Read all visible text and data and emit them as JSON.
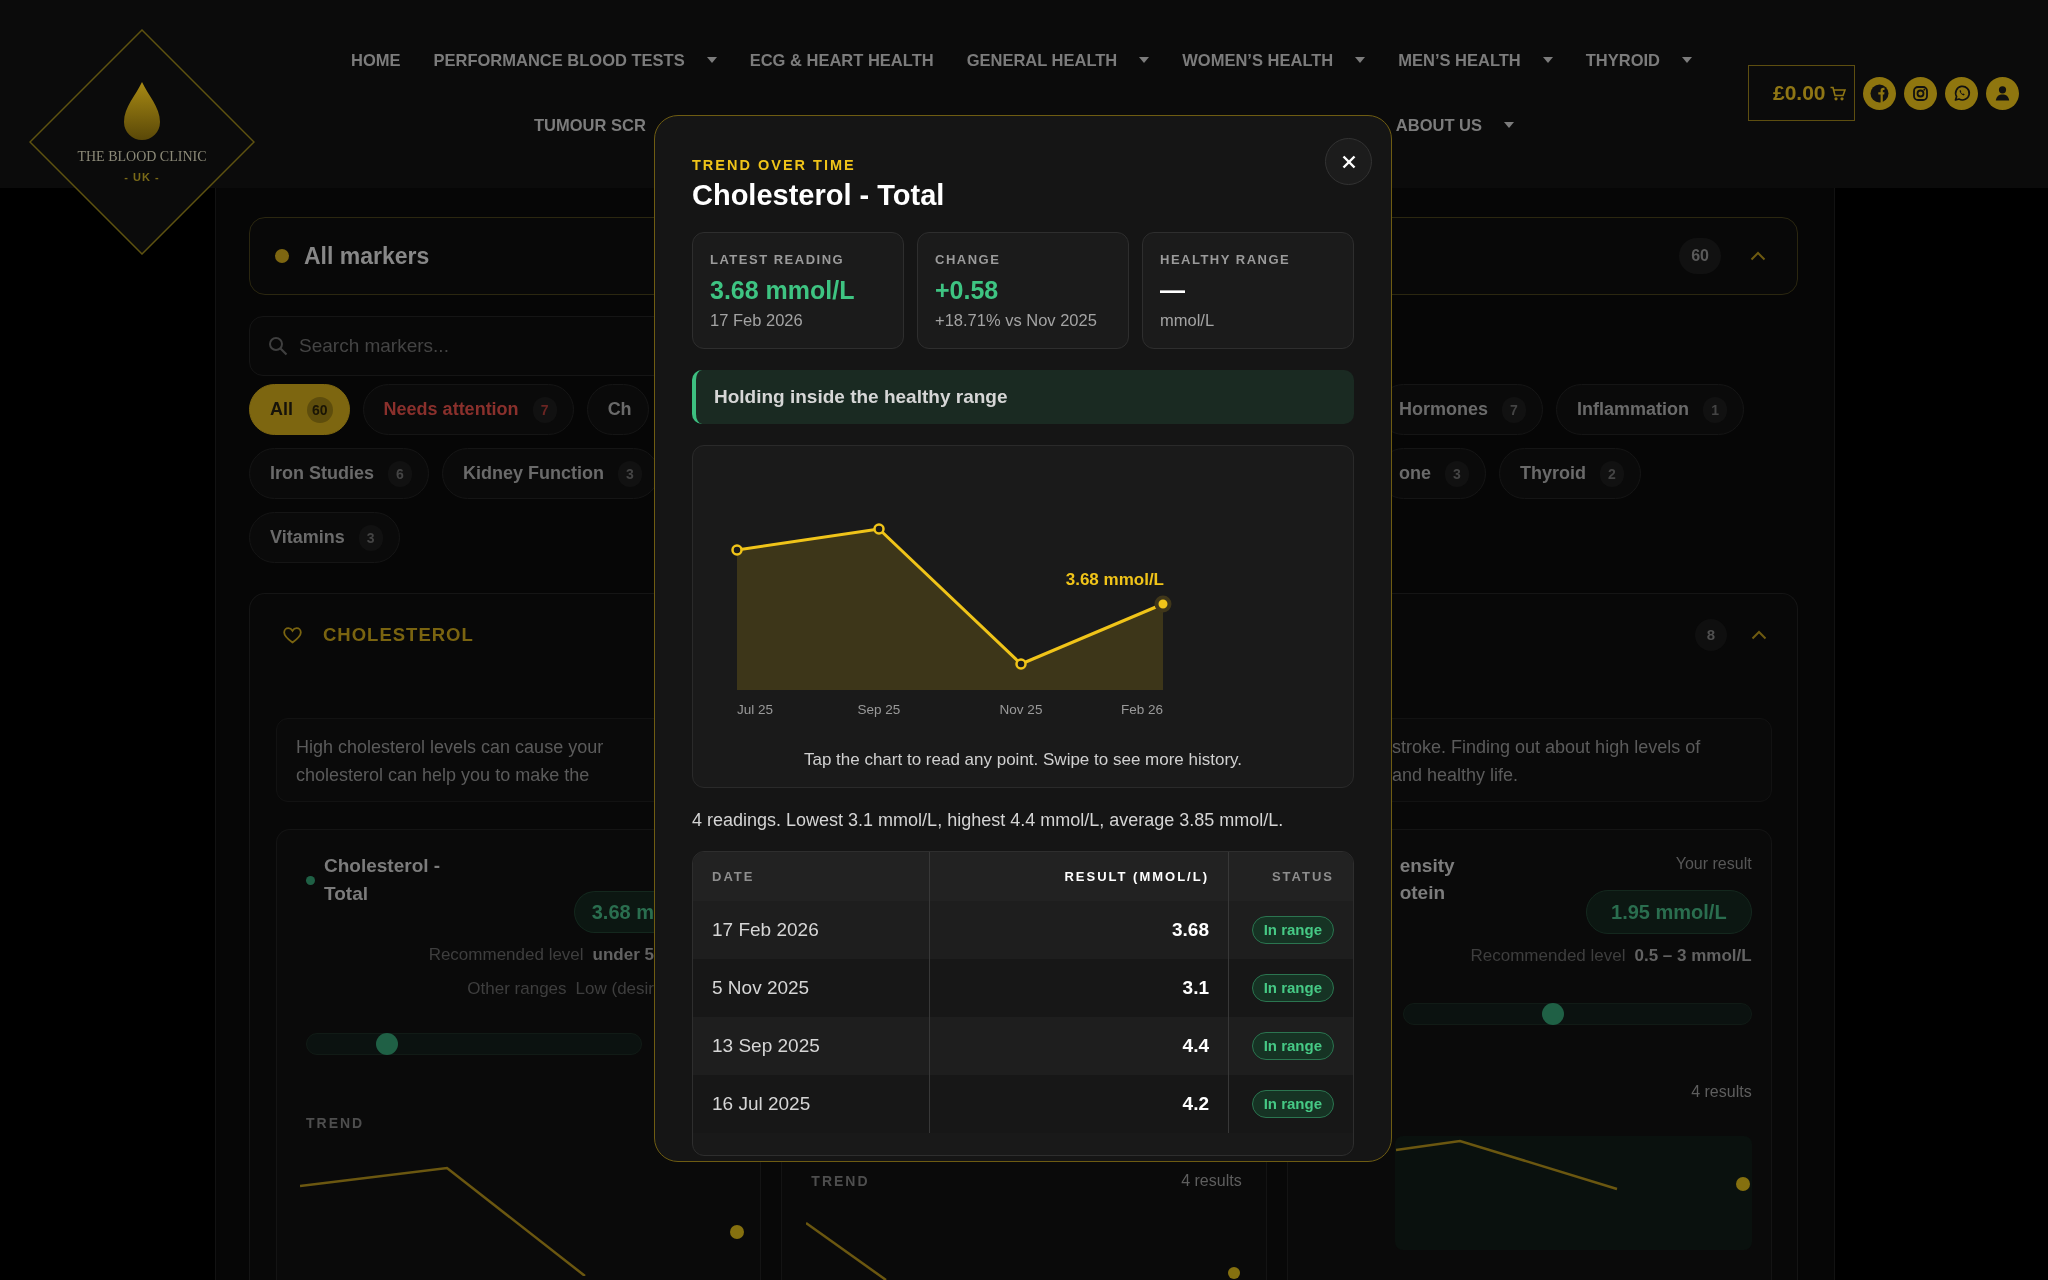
{
  "header": {
    "logo": {
      "name": "THE BLOOD CLINIC",
      "tagline": "- UK -"
    },
    "nav_rows": [
      [
        {
          "label": "HOME",
          "dropdown": false
        },
        {
          "label": "PERFORMANCE BLOOD TESTS",
          "dropdown": true
        },
        {
          "label": "ECG & HEART HEALTH",
          "dropdown": false
        },
        {
          "label": "GENERAL HEALTH",
          "dropdown": true
        },
        {
          "label": "WOMEN’S HEALTH",
          "dropdown": true
        },
        {
          "label": "MEN’S HEALTH",
          "dropdown": true
        },
        {
          "label": "THYROID",
          "dropdown": true
        }
      ],
      [
        {
          "label": "TUMOUR SCR",
          "dropdown": false
        },
        {
          "label": "ABOUT US",
          "dropdown": true
        }
      ]
    ],
    "cart": {
      "total": "£0.00"
    }
  },
  "markers_bar": {
    "title": "All markers",
    "count": "60",
    "expanded": true
  },
  "search": {
    "placeholder": "Search markers..."
  },
  "filter_chips_left": [
    {
      "label": "All",
      "count": "60",
      "selected": true,
      "kind": "category"
    },
    {
      "label": "Needs attention",
      "count": "7",
      "selected": false,
      "kind": "attention"
    },
    {
      "label": "Ch",
      "selected": false,
      "kind": "category"
    },
    {
      "label": "Iron Studies",
      "count": "6",
      "selected": false,
      "kind": "category"
    },
    {
      "label": "Kidney Function",
      "count": "3",
      "selected": false,
      "kind": "category"
    },
    {
      "label": "Vitamins",
      "count": "3",
      "selected": false,
      "kind": "category"
    }
  ],
  "filter_chips_right": [
    {
      "label": "Hormones",
      "count": "7",
      "selected": false,
      "kind": "category"
    },
    {
      "label": "Inflammation",
      "count": "1",
      "selected": false,
      "kind": "category"
    },
    {
      "label": "one",
      "count": "3",
      "selected": false,
      "kind": "category"
    },
    {
      "label": "Thyroid",
      "count": "2",
      "selected": false,
      "kind": "category"
    }
  ],
  "section": {
    "title": "CHOLESTEROL",
    "count": "8",
    "expanded": true,
    "description_left": [
      "High cholesterol levels can cause your",
      "cholesterol can help you to make the"
    ],
    "description_right": [
      "stroke. Finding out about high levels of",
      "and healthy life."
    ],
    "left_card": {
      "title": "Cholesterol - Total",
      "value": "3.68 m",
      "recommended_label": "Recommended level",
      "recommended_value": "under 5",
      "other_label": "Other ranges",
      "other_value": "Low (desir",
      "level": 0.24,
      "trend_label": "TREND"
    },
    "middle_card": {
      "trend_label": "TREND",
      "results": "4 results"
    },
    "right_card": {
      "title_lines": [
        "ensity",
        "otein"
      ],
      "result_label": "Your result",
      "value": "1.95 mmol/L",
      "recommended_label": "Recommended level",
      "recommended_value": "0.5 – 3 mmol/L",
      "level": 0.43,
      "results": "4 results"
    }
  },
  "modal": {
    "eyebrow": "TREND OVER TIME",
    "title": "Cholesterol - Total",
    "stats": [
      {
        "label": "LATEST READING",
        "value": "3.68 mmol/L",
        "note": "17 Feb 2026",
        "kind": "positive"
      },
      {
        "label": "CHANGE",
        "value": "+0.58",
        "note": "+18.71% vs Nov 2025",
        "kind": "positive"
      },
      {
        "label": "HEALTHY RANGE",
        "value": "—",
        "note": "mmol/L",
        "kind": "neutral"
      }
    ],
    "banner": "Holding inside the healthy range",
    "chart": {
      "x_labels": [
        "Jul 25",
        "Sep 25",
        "Nov 25",
        "Feb 26"
      ],
      "point_label": "3.68 mmol/L"
    },
    "chart_caption": "Tap the chart to read any point. Swipe to see more history.",
    "summary": "4 readings. Lowest 3.1 mmol/L, highest 4.4 mmol/L, average 3.85 mmol/L.",
    "table": {
      "columns": [
        {
          "label": "DATE",
          "sorted": false
        },
        {
          "label": "RESULT (MMOL/L)",
          "sorted": true
        },
        {
          "label": "STATUS",
          "sorted": false
        }
      ],
      "rows": [
        {
          "date": "17 Feb 2026",
          "result": "3.68",
          "status": "In range"
        },
        {
          "date": "5 Nov 2025",
          "result": "3.1",
          "status": "In range"
        },
        {
          "date": "13 Sep 2025",
          "result": "4.4",
          "status": "In range"
        },
        {
          "date": "16 Jul 2025",
          "result": "4.2",
          "status": "In range"
        }
      ]
    }
  }
}
